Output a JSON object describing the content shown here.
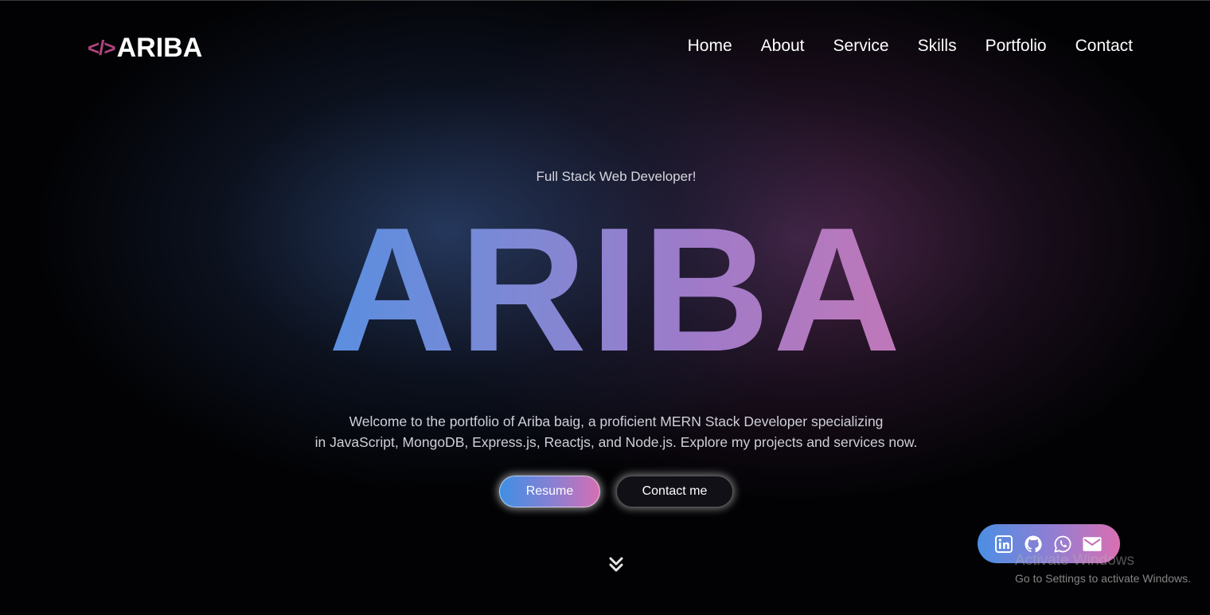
{
  "header": {
    "logo_icon": "</>",
    "logo_text": "ARIBA",
    "nav": [
      {
        "label": "Home"
      },
      {
        "label": "About"
      },
      {
        "label": "Service"
      },
      {
        "label": "Skills"
      },
      {
        "label": "Portfolio"
      },
      {
        "label": "Contact"
      }
    ]
  },
  "hero": {
    "subtitle": "Full Stack Web Developer!",
    "title": "ARIBA",
    "description_line1": "Welcome to the portfolio of Ariba baig, a proficient MERN Stack Developer specializing",
    "description_line2": "in JavaScript, MongoDB, Express.js, Reactjs, and Node.js. Explore my projects and services now.",
    "resume_label": "Resume",
    "contact_label": "Contact me"
  },
  "social": {
    "icons": [
      "linkedin-icon",
      "github-icon",
      "whatsapp-icon",
      "mail-icon"
    ]
  },
  "watermark": {
    "title": "Activate Windows",
    "subtitle": "Go to Settings to activate Windows."
  },
  "colors": {
    "accent_blue": "#4a8fe4",
    "accent_pink": "#db6fb2",
    "logo_icon": "#b0457e",
    "background": "#020204"
  }
}
